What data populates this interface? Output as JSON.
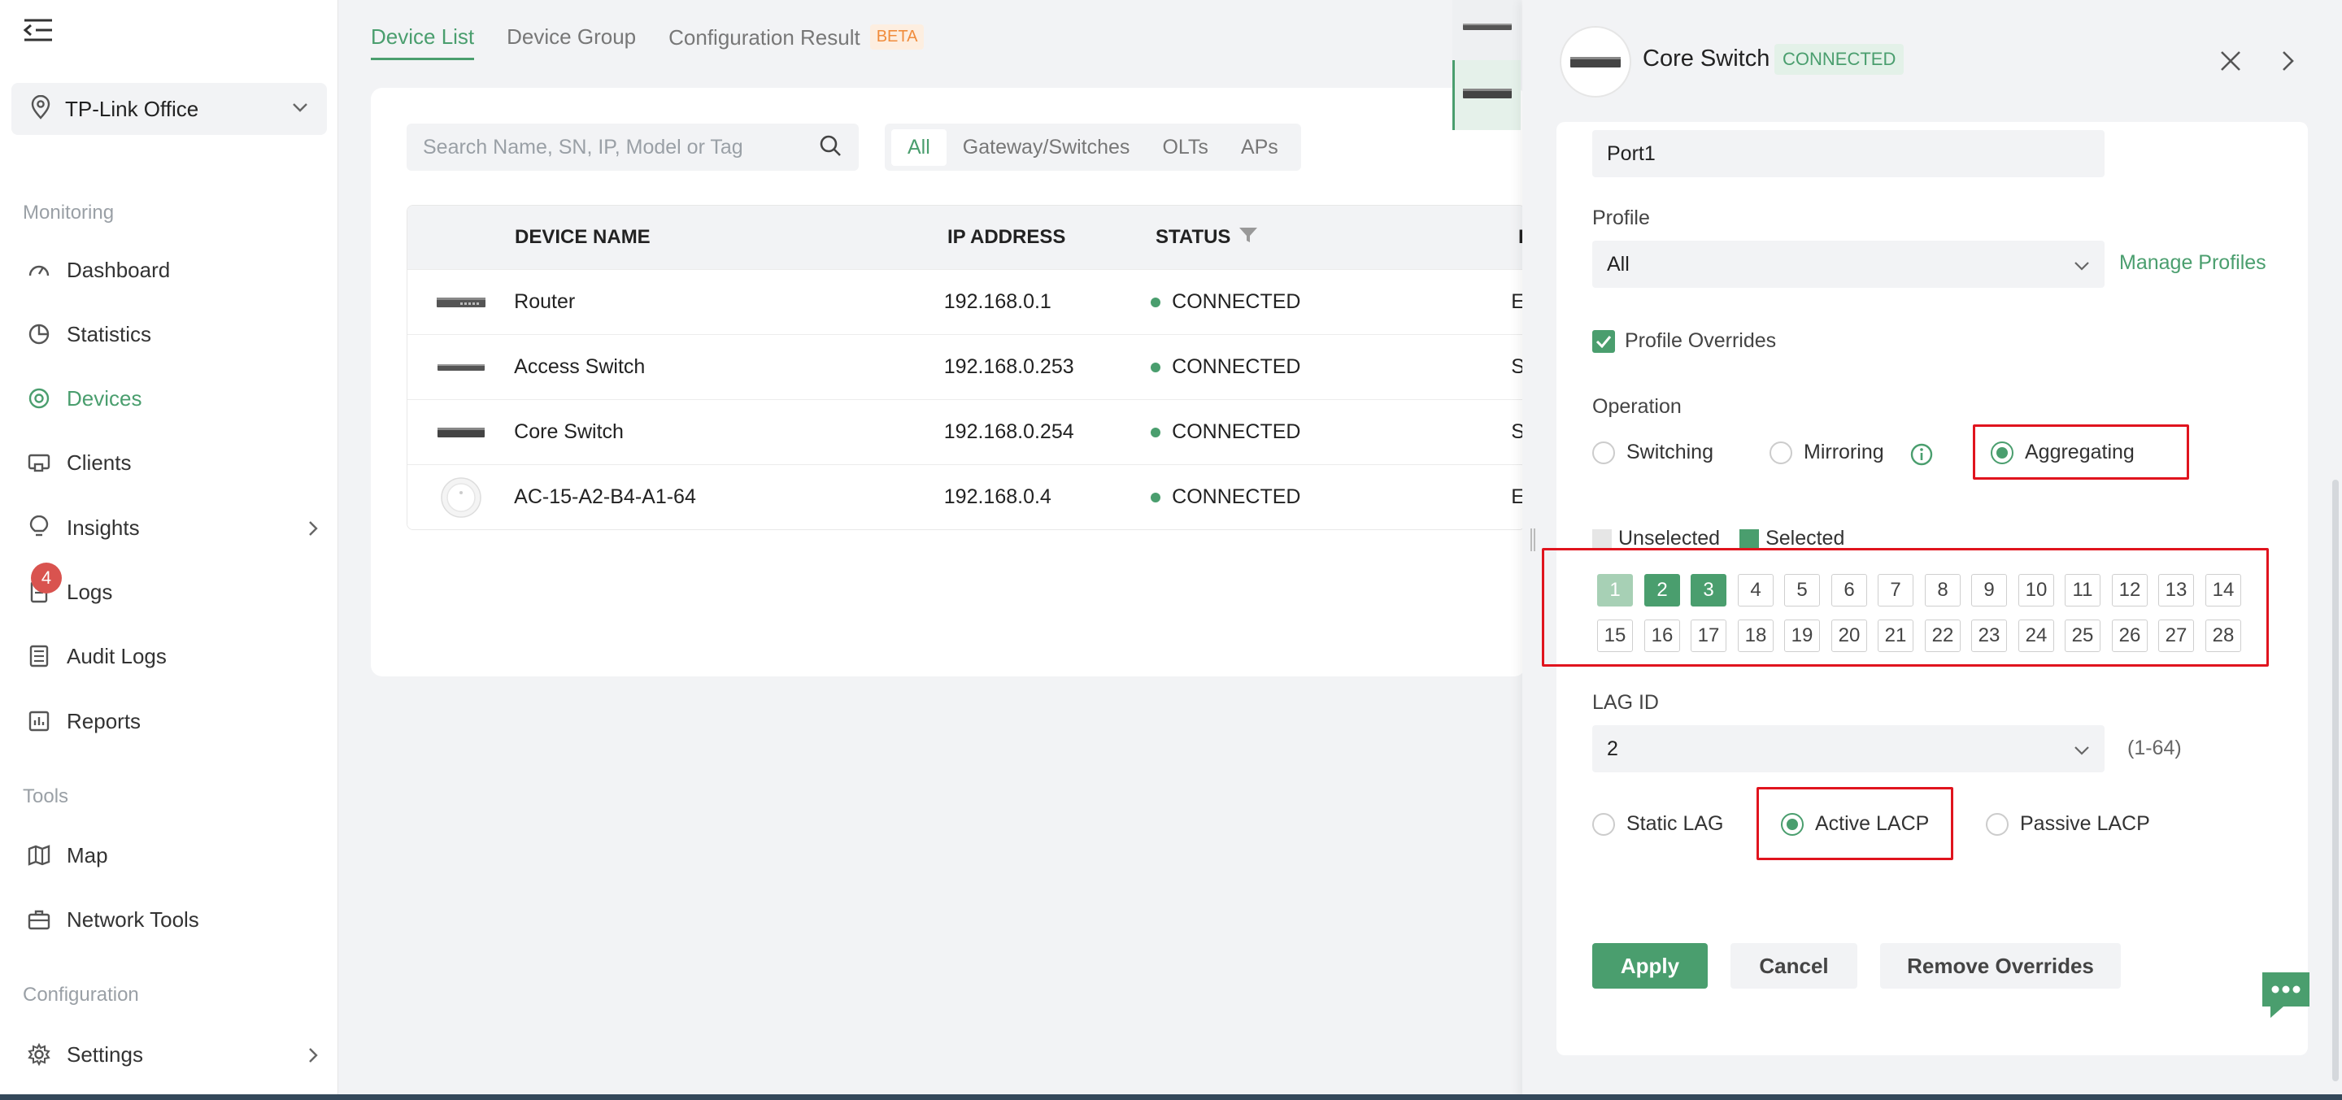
{
  "sidebar": {
    "site": "TP-Link Office",
    "sections": {
      "monitoring": "Monitoring",
      "tools": "Tools",
      "configuration": "Configuration"
    },
    "items": {
      "dashboard": "Dashboard",
      "statistics": "Statistics",
      "devices": "Devices",
      "clients": "Clients",
      "insights": "Insights",
      "logs": "Logs",
      "audit_logs": "Audit Logs",
      "reports": "Reports",
      "map": "Map",
      "network_tools": "Network Tools",
      "settings": "Settings"
    },
    "logs_badge": "4"
  },
  "main": {
    "tabs": {
      "device_list": "Device List",
      "device_group": "Device Group",
      "config_result": "Configuration Result",
      "beta": "BETA"
    },
    "search_placeholder": "Search Name, SN, IP, Model or Tag",
    "filters": {
      "all": "All",
      "gateway": "Gateway/Switches",
      "olts": "OLTs",
      "aps": "APs"
    },
    "columns": {
      "name": "DEVICE NAME",
      "ip": "IP ADDRESS",
      "status": "STATUS",
      "next": "I"
    },
    "rows": [
      {
        "name": "Router",
        "ip": "192.168.0.1",
        "status": "CONNECTED",
        "trunc": "E"
      },
      {
        "name": "Access Switch",
        "ip": "192.168.0.253",
        "status": "CONNECTED",
        "trunc": "S"
      },
      {
        "name": "Core Switch",
        "ip": "192.168.0.254",
        "status": "CONNECTED",
        "trunc": "S"
      },
      {
        "name": "AC-15-A2-B4-A1-64",
        "ip": "192.168.0.4",
        "status": "CONNECTED",
        "trunc": "E"
      }
    ]
  },
  "drawer": {
    "title": "Core Switch",
    "status": "CONNECTED",
    "port_name": "Port1",
    "profile_label": "Profile",
    "profile_value": "All",
    "manage_profiles": "Manage Profiles",
    "profile_overrides": "Profile Overrides",
    "operation_label": "Operation",
    "operations": {
      "switching": "Switching",
      "mirroring": "Mirroring",
      "aggregating": "Aggregating"
    },
    "legend": {
      "unselected": "Unselected",
      "selected": "Selected"
    },
    "ports_row1": [
      "1",
      "2",
      "3",
      "4",
      "5",
      "6",
      "7",
      "8",
      "9",
      "10",
      "11",
      "12",
      "13",
      "14"
    ],
    "ports_row2": [
      "15",
      "16",
      "17",
      "18",
      "19",
      "20",
      "21",
      "22",
      "23",
      "24",
      "25",
      "26",
      "27",
      "28"
    ],
    "lag_id_label": "LAG ID",
    "lag_id_value": "2",
    "lag_range": "(1-64)",
    "lag_modes": {
      "static": "Static LAG",
      "active": "Active LACP",
      "passive": "Passive LACP"
    },
    "buttons": {
      "apply": "Apply",
      "cancel": "Cancel",
      "remove": "Remove Overrides"
    }
  },
  "colors": {
    "accent": "#4a9e6e",
    "highlight": "#e0141e"
  }
}
